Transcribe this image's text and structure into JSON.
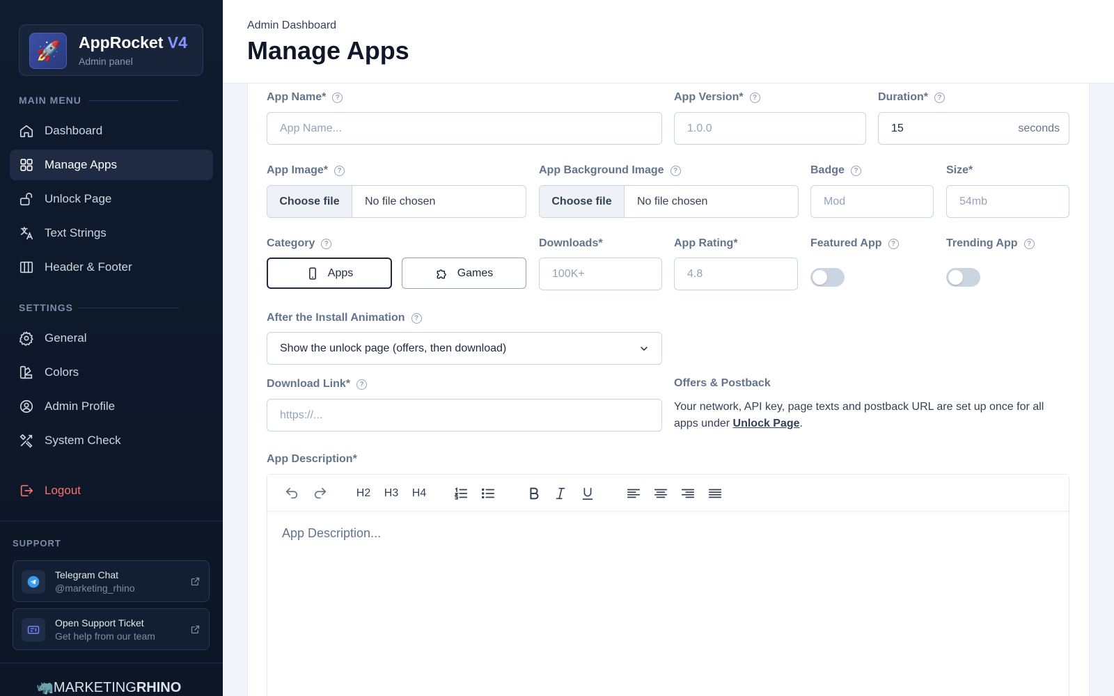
{
  "sidebar": {
    "brand": {
      "name": "AppRocket",
      "version": "V4",
      "subtitle": "Admin panel",
      "logo_icon": "rocket-icon"
    },
    "main_menu_label": "MAIN MENU",
    "settings_label": "SETTINGS",
    "main_items": [
      {
        "label": "Dashboard",
        "icon": "home-icon",
        "active": false
      },
      {
        "label": "Manage Apps",
        "icon": "grid-icon",
        "active": true
      },
      {
        "label": "Unlock Page",
        "icon": "unlock-icon",
        "active": false
      },
      {
        "label": "Text Strings",
        "icon": "translate-icon",
        "active": false
      },
      {
        "label": "Header & Footer",
        "icon": "columns-icon",
        "active": false
      }
    ],
    "settings_items": [
      {
        "label": "General",
        "icon": "gear-icon"
      },
      {
        "label": "Colors",
        "icon": "palette-icon"
      },
      {
        "label": "Admin Profile",
        "icon": "user-circle-icon"
      },
      {
        "label": "System Check",
        "icon": "tools-icon"
      }
    ],
    "logout_label": "Logout",
    "support_label": "SUPPORT",
    "support_cards": [
      {
        "title": "Telegram Chat",
        "subtitle": "@marketing_rhino",
        "icon": "telegram-icon"
      },
      {
        "title": "Open Support Ticket",
        "subtitle": "Get help from our team",
        "icon": "ticket-icon"
      }
    ],
    "footer_logo": {
      "part1": "MARKETING",
      "part2": "RHINO"
    }
  },
  "header": {
    "breadcrumb": "Admin Dashboard",
    "title": "Manage Apps"
  },
  "form": {
    "app_name": {
      "label": "App Name*",
      "placeholder": "App Name..."
    },
    "app_version": {
      "label": "App Version*",
      "placeholder": "1.0.0"
    },
    "duration": {
      "label": "Duration*",
      "value": "15",
      "suffix": "seconds"
    },
    "app_image": {
      "label": "App Image*",
      "button": "Choose file",
      "status": "No file chosen"
    },
    "app_bg_image": {
      "label": "App Background Image",
      "button": "Choose file",
      "status": "No file chosen"
    },
    "badge": {
      "label": "Badge",
      "placeholder": "Mod"
    },
    "size": {
      "label": "Size*",
      "placeholder": "54mb"
    },
    "category": {
      "label": "Category",
      "options": [
        "Apps",
        "Games"
      ],
      "selected": "Apps"
    },
    "downloads": {
      "label": "Downloads*",
      "placeholder": "100K+"
    },
    "app_rating": {
      "label": "App Rating*",
      "placeholder": "4.8"
    },
    "featured_app": {
      "label": "Featured App",
      "on": false
    },
    "trending_app": {
      "label": "Trending App",
      "on": false
    },
    "after_install": {
      "label": "After the Install Animation",
      "selected": "Show the unlock page (offers, then download)"
    },
    "download_link": {
      "label": "Download Link*",
      "placeholder": "https://..."
    },
    "offers": {
      "title": "Offers & Postback",
      "text_before": "Your network, API key, page texts and postback URL are set up once for all apps under ",
      "link": "Unlock Page",
      "text_after": "."
    },
    "description": {
      "label": "App Description*",
      "placeholder": "App Description...",
      "toolbar": {
        "h2": "H2",
        "h3": "H3",
        "h4": "H4"
      }
    }
  },
  "colors": {
    "sidebar_bg": "#0f1b2e",
    "accent": "#8b93ff",
    "logout": "#f87171"
  }
}
